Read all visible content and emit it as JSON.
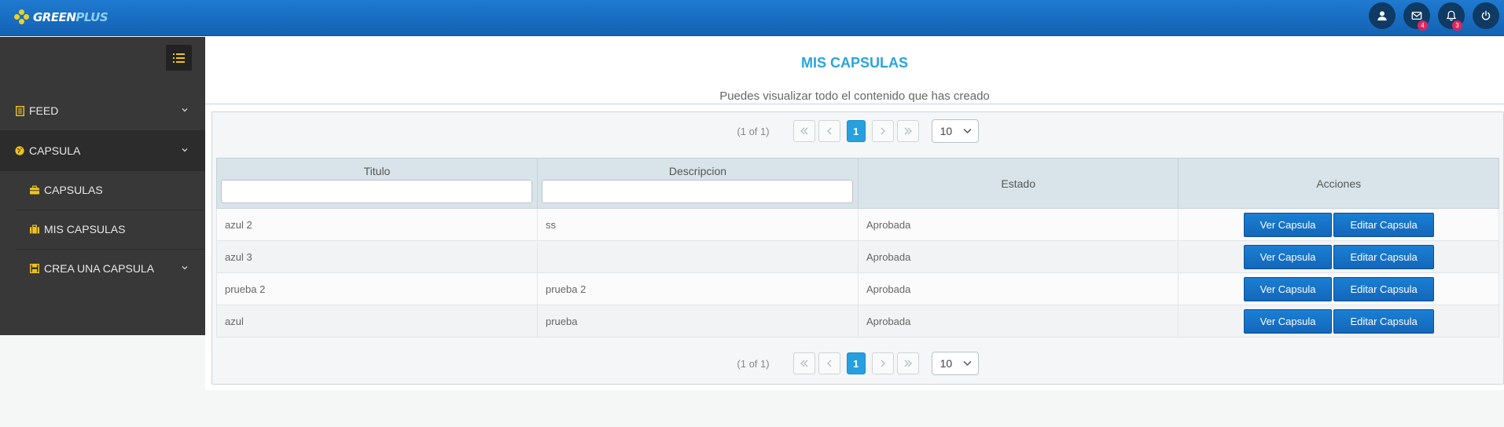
{
  "topbar": {
    "brand_part1": "GREEN",
    "brand_part2": "PLUS",
    "logo_icon": "hexagon-dots-logo",
    "icons": [
      {
        "name": "user-icon"
      },
      {
        "name": "mail-icon",
        "badge": "4"
      },
      {
        "name": "bell-icon",
        "badge": "3"
      },
      {
        "name": "power-icon"
      }
    ],
    "badge_color": "#e0245e"
  },
  "sidebar": {
    "toggle_icon": "list-icon",
    "items": [
      {
        "label": "FEED",
        "icon": "document-icon",
        "expandable": true
      },
      {
        "label": "CAPSULA",
        "icon": "globe-icon",
        "expandable": true
      },
      {
        "label": "CAPSULAS",
        "icon": "briefcase-icon",
        "expandable": false
      },
      {
        "label": "MIS CAPSULAS",
        "icon": "suitcase-icon",
        "expandable": false
      },
      {
        "label": "CREA UNA CAPSULA",
        "icon": "save-icon",
        "expandable": true
      }
    ],
    "icon_color": "#f0c419"
  },
  "main": {
    "title": "MIS CAPSULAS",
    "subtitle": "Puedes visualizar todo el contenido que has creado",
    "accent_color": "#2aa3e0"
  },
  "paginator": {
    "count": "(1 of 1)",
    "current_page": "1",
    "rows_per_page": "10"
  },
  "table": {
    "headers": {
      "titulo": "Titulo",
      "descripcion": "Descripcion",
      "estado": "Estado",
      "acciones": "Acciones"
    },
    "rows": [
      {
        "titulo": "azul 2",
        "descripcion": "ss",
        "estado": "Aprobada"
      },
      {
        "titulo": "azul 3",
        "descripcion": "",
        "estado": "Aprobada"
      },
      {
        "titulo": "prueba 2",
        "descripcion": "prueba 2",
        "estado": "Aprobada"
      },
      {
        "titulo": "azul",
        "descripcion": "prueba",
        "estado": "Aprobada"
      }
    ],
    "view_label": "Ver Capsula",
    "edit_label": "Editar Capsula"
  }
}
